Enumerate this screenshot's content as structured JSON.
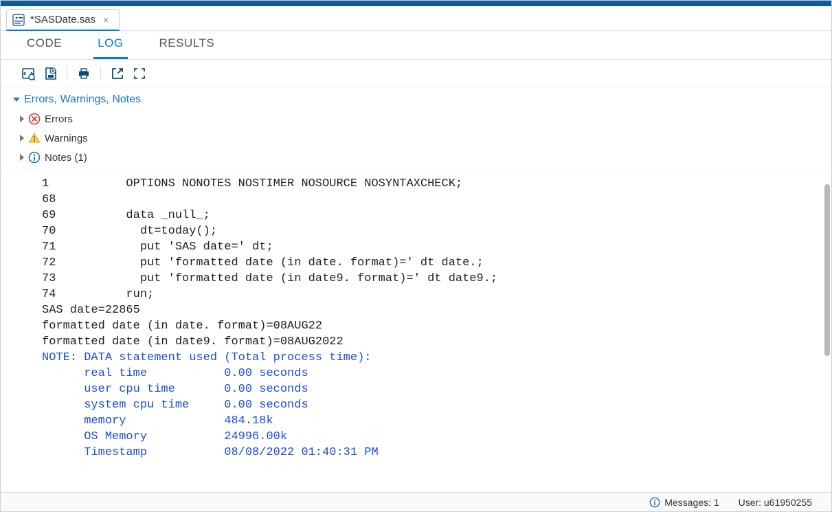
{
  "file_tab": {
    "title": "*SASDate.sas",
    "icon_name": "sas-program-icon"
  },
  "sub_tabs": {
    "code": "CODE",
    "log": "LOG",
    "results": "RESULTS",
    "active": "log"
  },
  "toolbar": {
    "btn_view_html": "html-snippet-icon",
    "btn_save_log": "save-log-icon",
    "btn_print": "print-icon",
    "btn_popout": "pop-out-icon",
    "btn_fullscreen": "fullscreen-icon"
  },
  "summary": {
    "header": "Errors, Warnings, Notes",
    "errors_label": "Errors",
    "warnings_label": "Warnings",
    "notes_label": "Notes (1)"
  },
  "log_lines": [
    {
      "n": "1",
      "t": "         OPTIONS NONOTES NOSTIMER NOSOURCE NOSYNTAXCHECK;",
      "c": ""
    },
    {
      "n": "68",
      "t": "",
      "c": ""
    },
    {
      "n": "69",
      "t": "         data _null_;",
      "c": ""
    },
    {
      "n": "70",
      "t": "           dt=today();",
      "c": ""
    },
    {
      "n": "71",
      "t": "           put 'SAS date=' dt;",
      "c": ""
    },
    {
      "n": "72",
      "t": "           put 'formatted date (in date. format)=' dt date.;",
      "c": ""
    },
    {
      "n": "73",
      "t": "           put 'formatted date (in date9. format)=' dt date9.;",
      "c": ""
    },
    {
      "n": "74",
      "t": "         run;",
      "c": ""
    },
    {
      "n": "",
      "t": "",
      "c": ""
    },
    {
      "n": "",
      "t": "SAS date=22865",
      "c": ""
    },
    {
      "n": "",
      "t": "formatted date (in date. format)=08AUG22",
      "c": ""
    },
    {
      "n": "",
      "t": "formatted date (in date9. format)=08AUG2022",
      "c": ""
    },
    {
      "n": "",
      "t": "NOTE: DATA statement used (Total process time):",
      "c": "note"
    },
    {
      "n": "",
      "t": "      real time           0.00 seconds",
      "c": "note"
    },
    {
      "n": "",
      "t": "      user cpu time       0.00 seconds",
      "c": "note"
    },
    {
      "n": "",
      "t": "      system cpu time     0.00 seconds",
      "c": "note"
    },
    {
      "n": "",
      "t": "      memory              484.18k",
      "c": "note"
    },
    {
      "n": "",
      "t": "      OS Memory           24996.00k",
      "c": "note"
    },
    {
      "n": "",
      "t": "      Timestamp           08/08/2022 01:40:31 PM",
      "c": "note"
    }
  ],
  "status": {
    "messages_label": "Messages: 1",
    "user_label": "User: u61950255"
  }
}
